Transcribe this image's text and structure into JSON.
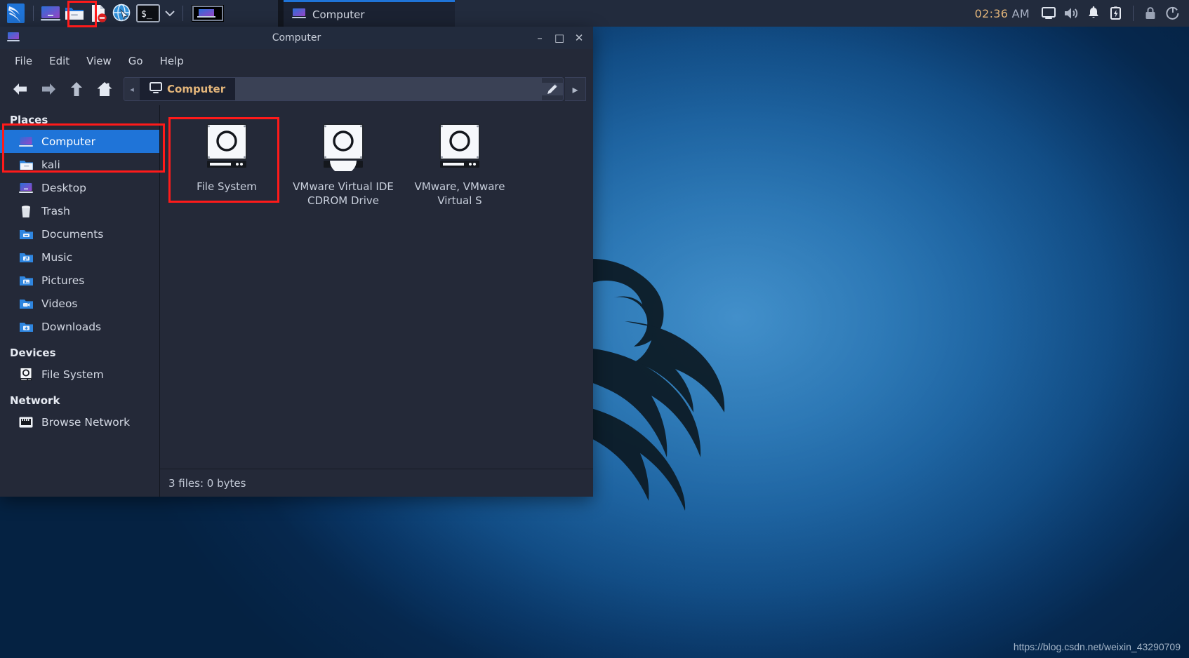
{
  "panel": {
    "launchers": [
      {
        "name": "kali-menu-icon",
        "label": "Kali Menu"
      },
      {
        "name": "show-desktop-icon",
        "label": "Show Desktop"
      },
      {
        "name": "file-manager-icon",
        "label": "File Manager"
      },
      {
        "name": "text-editor-icon",
        "label": "Text Editor"
      },
      {
        "name": "web-browser-icon",
        "label": "Web Browser"
      },
      {
        "name": "terminal-icon",
        "label": "Terminal"
      },
      {
        "name": "terminal-dropdown-icon",
        "label": "Terminal Options"
      }
    ],
    "workspace_label": "Workspace 1",
    "tasks": [
      {
        "label": "Computer",
        "icon": "computer-icon",
        "active": true
      }
    ],
    "clock": {
      "time": "02:36",
      "ampm": "AM"
    },
    "tray": [
      {
        "name": "display-icon",
        "label": "Display"
      },
      {
        "name": "volume-icon",
        "label": "Volume"
      },
      {
        "name": "notification-bell-icon",
        "label": "Notifications"
      },
      {
        "name": "battery-icon",
        "label": "Battery"
      },
      {
        "name": "lock-icon",
        "label": "Lock Screen"
      },
      {
        "name": "power-icon",
        "label": "Session and Power"
      }
    ]
  },
  "window": {
    "title": "Computer",
    "minimize": "–",
    "maximize": "□",
    "close": "✕",
    "menus": [
      "File",
      "Edit",
      "View",
      "Go",
      "Help"
    ],
    "toolbar": {
      "back": "back-arrow-icon",
      "forward": "forward-arrow-icon",
      "up": "up-arrow-icon",
      "home": "home-icon",
      "scroll_left": "◂",
      "scroll_right": "▸"
    },
    "pathbar": {
      "crumb": "Computer",
      "edit_tooltip": "Toggle Location Entry"
    },
    "sidebar": {
      "sections": [
        {
          "title": "Places",
          "items": [
            {
              "label": "Computer",
              "icon": "computer-icon",
              "selected": true
            },
            {
              "label": "kali",
              "icon": "home-folder-icon",
              "selected": false
            },
            {
              "label": "Desktop",
              "icon": "desktop-icon",
              "selected": false
            },
            {
              "label": "Trash",
              "icon": "trash-icon",
              "selected": false
            },
            {
              "label": "Documents",
              "icon": "documents-folder-icon",
              "selected": false
            },
            {
              "label": "Music",
              "icon": "music-folder-icon",
              "selected": false
            },
            {
              "label": "Pictures",
              "icon": "pictures-folder-icon",
              "selected": false
            },
            {
              "label": "Videos",
              "icon": "videos-folder-icon",
              "selected": false
            },
            {
              "label": "Downloads",
              "icon": "downloads-folder-icon",
              "selected": false
            }
          ]
        },
        {
          "title": "Devices",
          "items": [
            {
              "label": "File System",
              "icon": "drive-harddisk-icon",
              "selected": false
            }
          ]
        },
        {
          "title": "Network",
          "items": [
            {
              "label": "Browse Network",
              "icon": "network-icon",
              "selected": false
            }
          ]
        }
      ]
    },
    "items": [
      {
        "label": "File System",
        "icon": "drive-harddisk-icon",
        "highlighted": true
      },
      {
        "label": "VMware Virtual IDE CDROM Drive",
        "icon": "drive-cdrom-icon",
        "highlighted": false
      },
      {
        "label": "VMware, VMware Virtual S",
        "icon": "drive-harddisk-icon",
        "highlighted": false
      }
    ],
    "statusbar": "3 files: 0 bytes"
  },
  "watermark": "https://blog.csdn.net/weixin_43290709",
  "colors": {
    "panel_bg": "#222b3d",
    "window_bg": "#242938",
    "selection_blue": "#1f74d8",
    "accent_orange": "#e3b57a",
    "annotation_red": "#ff1a1a"
  }
}
